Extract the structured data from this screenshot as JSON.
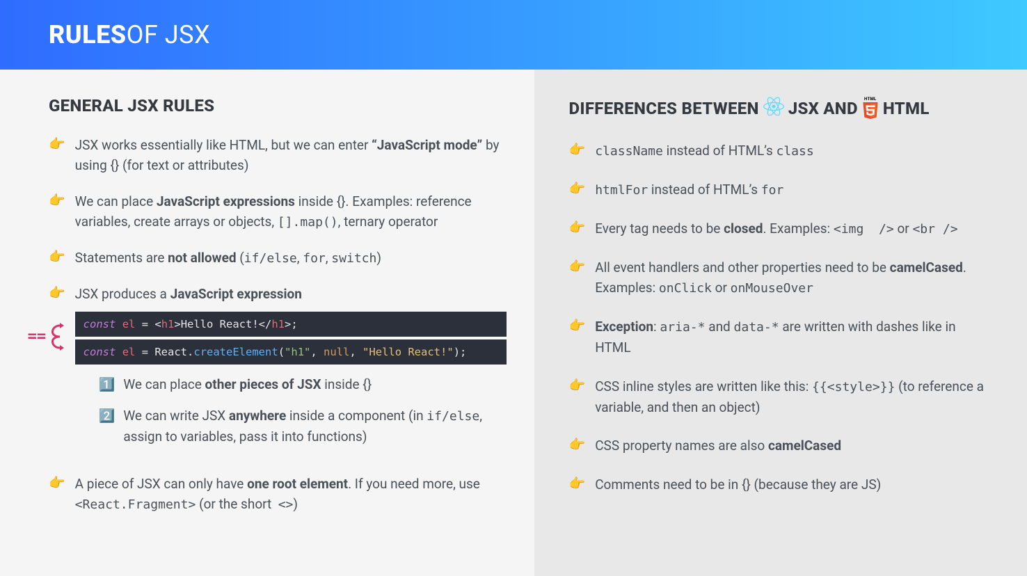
{
  "header": {
    "bold": "RULES",
    "rest": " OF JSX"
  },
  "left": {
    "title": "GENERAL JSX RULES",
    "items": [
      {
        "html": "JSX works essentially like HTML, but we can enter <b>“JavaScript mode”</b> by using {} (for text or attributes)"
      },
      {
        "html": "We can place <b>JavaScript expressions</b> inside {}. Examples: reference variables, create arrays or objects, <span class='mono'>[].map()</span>, ternary operator"
      },
      {
        "html": "Statements are <b>not allowed</b> (<span class='mono'>if/else</span>, <span class='mono'>for</span>, <span class='mono'>switch</span>)"
      },
      {
        "html": "JSX produces a <b>JavaScript expression</b>",
        "code": {
          "eq": "==",
          "line1_html": "<span class='kw-const'>const</span> <span class='kw-var'>el</span> = &lt;<span class='kw-tag'>h1</span>&gt;Hello React!&lt;/<span class='kw-tag'>h1</span>&gt;;",
          "line2_html": "<span class='kw-const'>const</span> <span class='kw-var'>el</span> = React.<span class='kw-fn'>createElement</span>(<span class='kw-str'>\"h1\"</span>, <span class='kw-null'>null</span>, <span class='kw-str-hl'>\"Hello React!\"</span>);"
        },
        "subs": [
          {
            "badge": "1️⃣",
            "html": "We can place <b>other pieces of JSX</b> inside {}"
          },
          {
            "badge": "2️⃣",
            "html": "We can write JSX <b>anywhere</b> inside a component (in <span class='mono'>if/else</span>, assign to variables, pass it into functions)"
          }
        ]
      },
      {
        "html": "A piece of JSX can only have <b>one root element</b>. If you need more, use <span class='mono'>&lt;React.Fragment&gt;</span> (or the short&nbsp; <span class='mono'>&lt;&gt;</span>)"
      }
    ]
  },
  "right": {
    "title_pre": "DIFFERENCES BETWEEN ",
    "jsx": "JSX",
    "and": " AND ",
    "html": "HTML",
    "html5_tiny": "HTML",
    "items": [
      {
        "html": "<span class='mono'>className</span> instead of HTML’s <span class='mono'>class</span>"
      },
      {
        "html": "<span class='mono'>htmlFor</span> instead of HTML’s <span class='mono'>for</span>"
      },
      {
        "html": "Every tag needs to be <b>closed</b>. Examples: <span class='mono'>&lt;img&nbsp; /&gt;</span> or <span class='mono'>&lt;br /&gt;</span>"
      },
      {
        "html": "All event handlers and other properties need to be <b>camelCased</b>. Examples: <span class='mono'>onClick</span> or <span class='mono'>onMouseOver</span>"
      },
      {
        "html": "<b>Exception</b>: <span class='mono'>aria-*</span> and <span class='mono'>data-*</span> are written with dashes like in HTML"
      },
      {
        "html": "CSS inline styles are written like this: <span class='mono'>{{&lt;style&gt;}}</span> (to reference a variable, and then an object)"
      },
      {
        "html": "CSS property names are also <b>camelCased</b>"
      },
      {
        "html": "Comments need to be in {} (because they are JS)"
      }
    ]
  }
}
